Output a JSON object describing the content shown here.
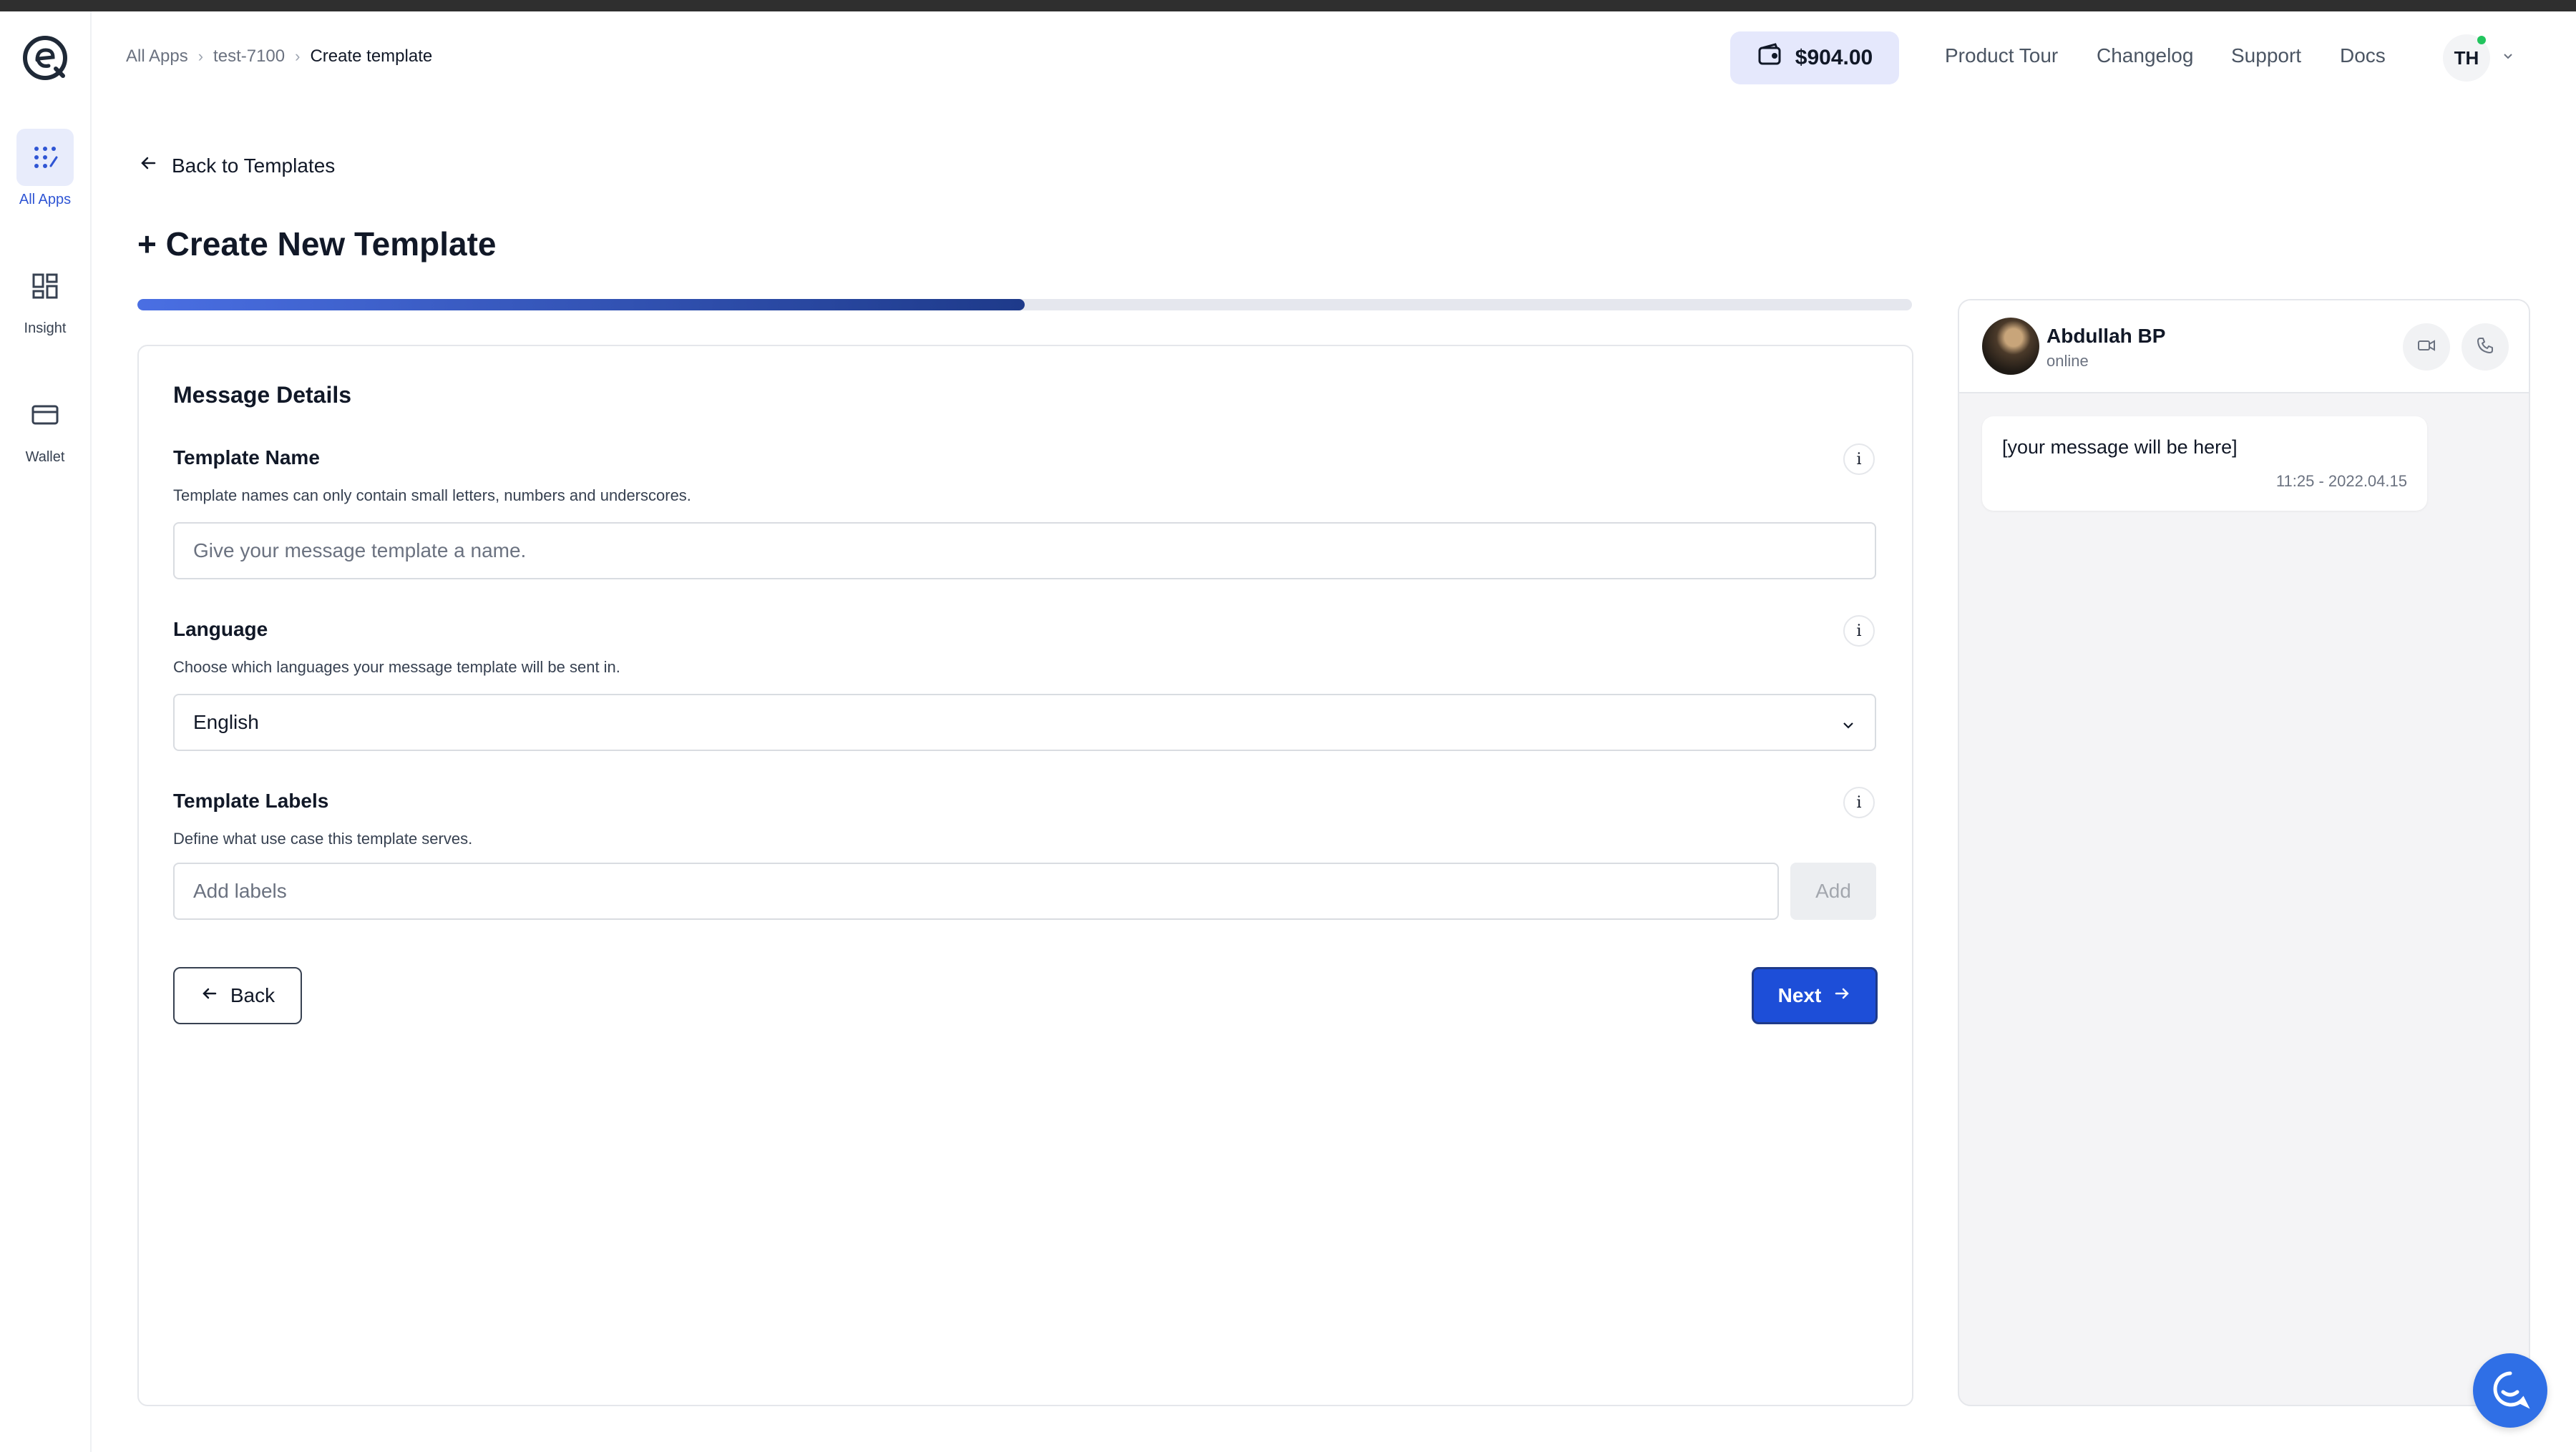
{
  "sidebar": {
    "items": [
      {
        "label": "All Apps",
        "icon": "grid-dots-icon",
        "active": true
      },
      {
        "label": "Insight",
        "icon": "dashboard-icon",
        "active": false
      },
      {
        "label": "Wallet",
        "icon": "credit-card-icon",
        "active": false
      }
    ]
  },
  "breadcrumb": {
    "items": [
      "All Apps",
      "test-7100",
      "Create template"
    ]
  },
  "header": {
    "wallet_balance": "$904.00",
    "nav": [
      "Product Tour",
      "Changelog",
      "Support",
      "Docs"
    ],
    "user_initials": "TH"
  },
  "page": {
    "back_link": "Back to Templates",
    "title": "+ Create New Template",
    "progress_percent": 50
  },
  "form": {
    "section_title": "Message Details",
    "template_name": {
      "label": "Template Name",
      "help": "Template names can only contain small letters, numbers and underscores.",
      "placeholder": "Give your message template a name.",
      "value": ""
    },
    "language": {
      "label": "Language",
      "help": "Choose which languages your message template will be sent in.",
      "selected": "English"
    },
    "labels": {
      "label": "Template Labels",
      "help": "Define what use case this template serves.",
      "placeholder": "Add labels",
      "add_button": "Add"
    },
    "back_button": "Back",
    "next_button": "Next"
  },
  "preview": {
    "contact_name": "Abdullah BP",
    "contact_status": "online",
    "message_text": "[your message will be here]",
    "message_time": "11:25 - 2022.04.15"
  },
  "colors": {
    "accent": "#1d4ed8",
    "wallet_bg": "#e5e8fc",
    "online": "#22c55e"
  }
}
